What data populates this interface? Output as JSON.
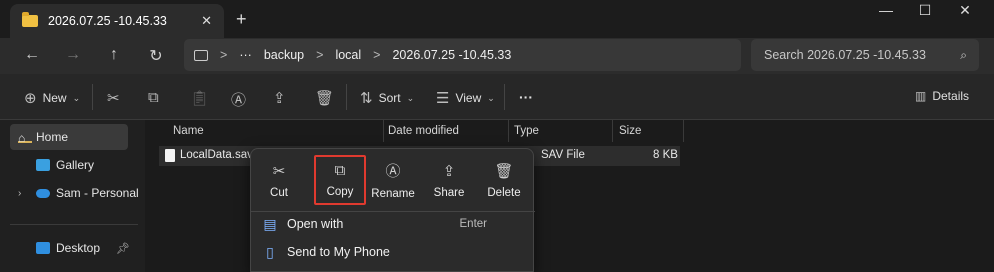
{
  "tab": {
    "title": "2026.07.25 -10.45.33",
    "close": "✕",
    "new": "+"
  },
  "window_controls": [
    "—",
    "☐",
    "✕"
  ],
  "nav": {
    "back": "←",
    "forward": "→",
    "up": "↑",
    "refresh": "↻"
  },
  "breadcrumb": {
    "more": "···",
    "items": [
      "backup",
      "local",
      "2026.07.25 -10.45.33"
    ],
    "separator": ">"
  },
  "search": {
    "placeholder": "Search 2026.07.25 -10.45.33"
  },
  "toolbar": {
    "new_label": "New",
    "sort_label": "Sort",
    "view_label": "View",
    "more": "···",
    "details_label": "Details"
  },
  "sidebar": {
    "items": [
      {
        "label": "Home"
      },
      {
        "label": "Gallery"
      },
      {
        "label": "Sam - Personal"
      },
      {
        "label": "Desktop"
      }
    ]
  },
  "columns": {
    "name": "Name",
    "date": "Date modified",
    "type": "Type",
    "size": "Size"
  },
  "files": [
    {
      "name": "LocalData.sav",
      "type": "SAV File",
      "size": "8 KB"
    }
  ],
  "context_menu": {
    "quick_actions": [
      {
        "label": "Cut",
        "icon": "cut-icon"
      },
      {
        "label": "Copy",
        "icon": "copy-icon"
      },
      {
        "label": "Rename",
        "icon": "rename-icon"
      },
      {
        "label": "Share",
        "icon": "share-icon"
      },
      {
        "label": "Delete",
        "icon": "delete-icon"
      }
    ],
    "items": [
      {
        "label": "Open with",
        "shortcut": "Enter"
      },
      {
        "label": "Send to My Phone",
        "shortcut": ""
      }
    ]
  },
  "colors": {
    "highlight": "#e03a2f",
    "folder": "#f0c042",
    "accent": "#7fb3ff"
  }
}
